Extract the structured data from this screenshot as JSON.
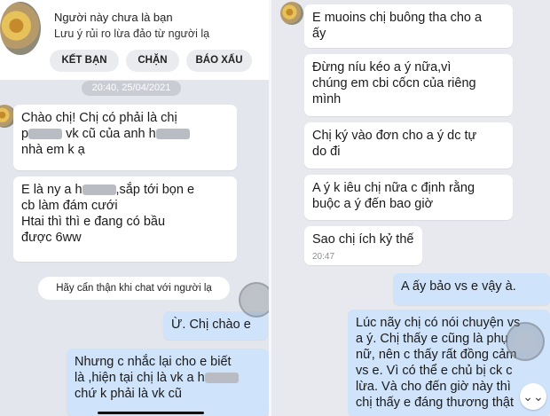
{
  "left": {
    "header": {
      "title": "Người này chưa là bạn",
      "subtitle": "Lưu ý rủi ro lừa đảo từ người lạ",
      "buttons": [
        "KẾT BẠN",
        "CHẶN",
        "BÁO XẤU"
      ]
    },
    "timestamp": "20:40, 25/04/2021",
    "messages": [
      {
        "lines": [
          "Chào chị! Chị có phải là chị",
          "p{blur} vk cũ của anh h{blur}",
          "nhà em k ạ"
        ]
      },
      {
        "lines": [
          "E là ny a h{blur},sắp tới bọn e",
          "cb làm đám cưới",
          "Htai thì thì e đang có bầu",
          "được 6ww"
        ]
      }
    ],
    "warning": "Hãy cẩn thận khi chat với người lạ",
    "mine": [
      {
        "lines": [
          "Ừ. Chị chào e"
        ]
      },
      {
        "lines": [
          "Nhưng c nhắc lại cho e biết",
          "là ,hiện tại chị là vk a h{blur}",
          "chứ k phải là vk cũ"
        ]
      }
    ]
  },
  "right": {
    "messages": [
      {
        "lines": [
          "E muoins chị buông tha cho a",
          "ấy"
        ]
      },
      {
        "lines": [
          "Đừng níu kéo a ý nữa,vì",
          "chúng em cbi cốcn của riêng",
          "mình"
        ]
      },
      {
        "lines": [
          "Chị ký vào đơn cho a ý dc tự",
          "do đi"
        ]
      },
      {
        "lines": [
          "A ý k iêu chị nữa c định rằng",
          "buộc a ý đến bao giờ"
        ]
      },
      {
        "lines": [
          "Sao chị ích kỷ thế"
        ],
        "time": "20:47"
      }
    ],
    "mine": [
      {
        "lines": [
          "A ấy bảo vs e vậy à."
        ]
      },
      {
        "lines": [
          "Lúc nãy chị có nói chuyện vs",
          "a ý. Chị thấy e cũng là phụ",
          "nữ, nên c thấy rất đồng cảm",
          "vs e. Vì có thể e chủ bị ck c",
          "lừa. Và cho đến giờ này thì",
          "chị thấy e đáng thương thật"
        ]
      }
    ],
    "scroll_icon": "chevron-down-icon"
  }
}
